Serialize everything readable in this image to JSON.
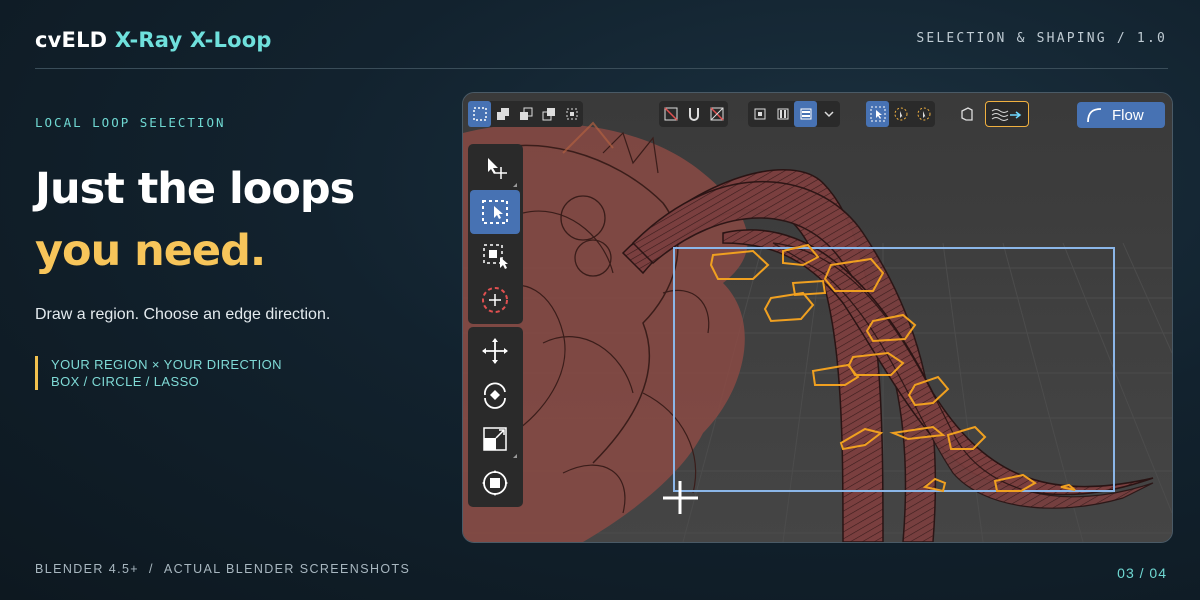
{
  "header": {
    "brand_part1": "cvELD",
    "brand_part2": "X-Ray X-Loop",
    "section_label": "SELECTION & SHAPING / 1.0"
  },
  "hero": {
    "kicker": "LOCAL LOOP SELECTION",
    "headline_line1": "Just the loops",
    "headline_line2": "you need.",
    "description": "Draw a region. Choose an edge direction.",
    "tags": [
      "YOUR REGION × YOUR DIRECTION",
      "BOX / CIRCLE / LASSO"
    ]
  },
  "footer": {
    "version": "BLENDER 4.5+",
    "separator": "/",
    "source": "ACTUAL BLENDER SCREENSHOTS",
    "page": "03 / 04"
  },
  "viewport": {
    "flow_button_label": "Flow",
    "top_icons": [
      "select-new-icon",
      "select-extend-icon",
      "select-subtract-icon",
      "select-invert-icon",
      "select-intersect-icon",
      "xray-off-icon",
      "magnet-icon",
      "xray-cross-icon",
      "loop-mode-a-icon",
      "loop-mode-b-icon",
      "loop-mode-c-icon",
      "dropdown-icon",
      "cursor-select-icon",
      "cursor-circle-icon",
      "cursor-lasso-icon",
      "face-icon",
      "flow-options-icon"
    ],
    "tools": [
      "tweak-tool",
      "box-select-tool",
      "extended-select-tool",
      "circle-select-tool",
      "move-tool",
      "rotate-tool",
      "scale-tool",
      "transform-tool"
    ],
    "active_tool": "box-select-tool"
  },
  "colors": {
    "accent_teal": "#6fe0dc",
    "accent_gold": "#f7c55a",
    "blender_blue": "#4772b3",
    "selection_orange": "#f0a020"
  }
}
